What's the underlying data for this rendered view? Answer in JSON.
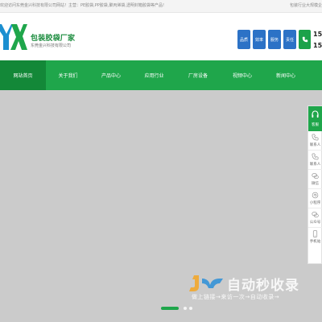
{
  "topbar": {
    "left_text": "欢迎访问东莞金兴科技有限公司网站！主营：PE胶袋,PP胶袋,聚丙烯袋,透明封箱胶袋等产品!",
    "right_text": "包装行业大规模企"
  },
  "brand": {
    "logo_text": "YX",
    "name": "包装胶袋厂家",
    "sub": "东莞金兴科技有限公司",
    "color": "#1b8c3e"
  },
  "quick_buttons": [
    {
      "label": "品质",
      "icon": ""
    },
    {
      "label": "效率",
      "icon": ""
    },
    {
      "label": "服务",
      "icon": ""
    },
    {
      "label": "责任",
      "icon": ""
    },
    {
      "label": "",
      "icon": "phone-icon"
    }
  ],
  "phone": {
    "line1": "15",
    "line2": "15"
  },
  "nav": {
    "items": [
      {
        "label": "网站首页",
        "active": true
      },
      {
        "label": "关于我们",
        "active": false
      },
      {
        "label": "产品中心",
        "active": false
      },
      {
        "label": "应用行业",
        "active": false
      },
      {
        "label": "厂房设备",
        "active": false
      },
      {
        "label": "视频中心",
        "active": false
      },
      {
        "label": "新闻中心",
        "active": false
      }
    ],
    "color": "#1fa64b",
    "active_color": "#138838"
  },
  "banner": {
    "background": "#cbcbcb",
    "slides": 3,
    "active_slide": 1
  },
  "watermark": {
    "title": "自动秒收录",
    "subtitle": "做上链接→来访一次→自动收录→"
  },
  "sidebar": {
    "top": {
      "label": "客服",
      "icon": "headset-icon"
    },
    "items": [
      {
        "label": "联系人",
        "icon": "phone-icon"
      },
      {
        "label": "联系人",
        "icon": "phone-icon"
      },
      {
        "label": "微信",
        "icon": "wechat-icon"
      },
      {
        "label": "小程序",
        "icon": "mini-program-icon"
      },
      {
        "label": "公众号",
        "icon": "official-account-icon"
      },
      {
        "label": "手机站",
        "icon": "mobile-icon"
      }
    ]
  }
}
